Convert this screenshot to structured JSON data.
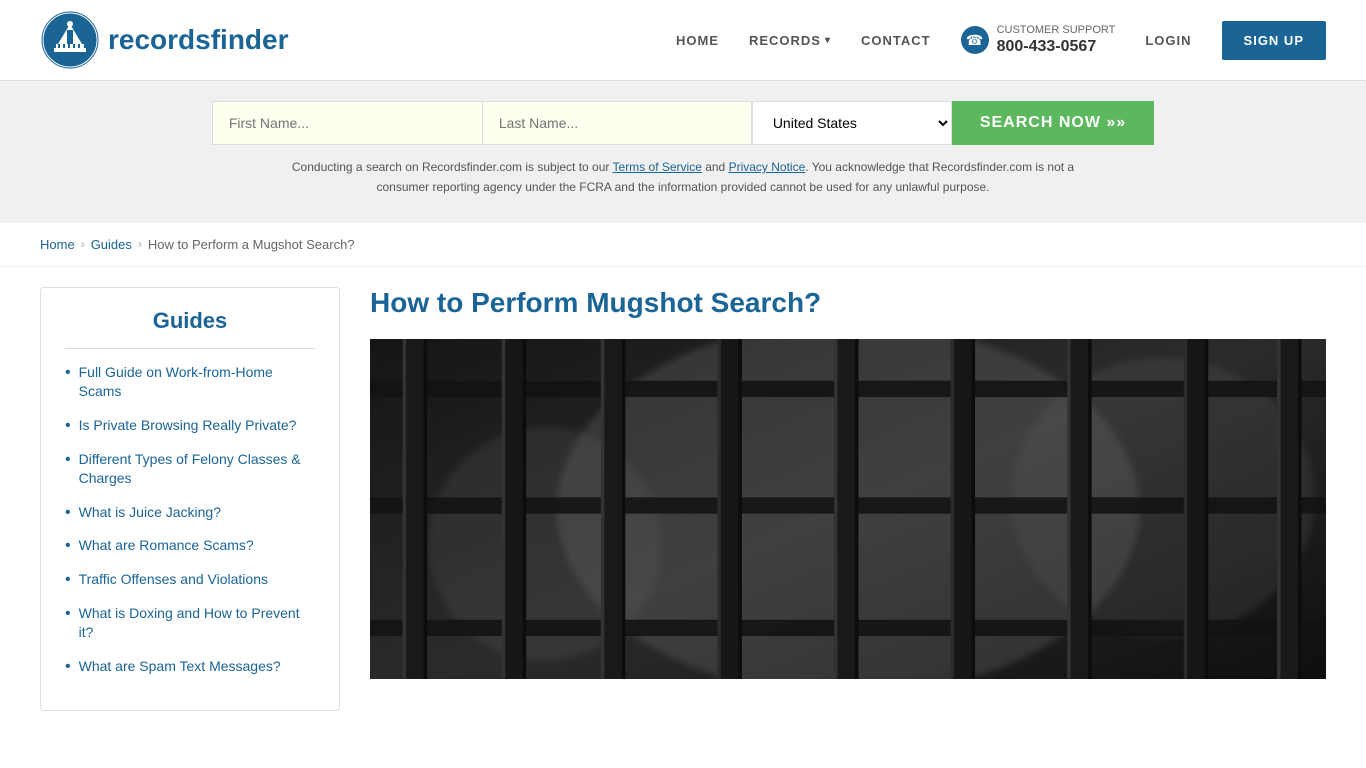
{
  "header": {
    "logo_text_regular": "records",
    "logo_text_bold": "finder",
    "nav": {
      "home_label": "HOME",
      "records_label": "RECORDS",
      "contact_label": "CONTACT",
      "support_label": "CUSTOMER SUPPORT",
      "support_phone": "800-433-0567",
      "login_label": "LOGIN",
      "signup_label": "SIGN UP"
    }
  },
  "search": {
    "first_name_placeholder": "First Name...",
    "last_name_placeholder": "Last Name...",
    "country_default": "United States",
    "country_options": [
      "United States"
    ],
    "search_button": "SEARCH NOW »»",
    "disclaimer": "Conducting a search on Recordsfinder.com is subject to our Terms of Service and Privacy Notice. You acknowledge that Recordsfinder.com is not a consumer reporting agency under the FCRA and the information provided cannot be used for any unlawful purpose.",
    "tos_label": "Terms of Service",
    "privacy_label": "Privacy Notice"
  },
  "breadcrumb": {
    "home": "Home",
    "guides": "Guides",
    "current": "How to Perform a Mugshot Search?"
  },
  "sidebar": {
    "title": "Guides",
    "items": [
      {
        "label": "Full Guide on Work-from-Home Scams"
      },
      {
        "label": "Is Private Browsing Really Private?"
      },
      {
        "label": "Different Types of Felony Classes & Charges"
      },
      {
        "label": "What is Juice Jacking?"
      },
      {
        "label": "What are Romance Scams?"
      },
      {
        "label": "Traffic Offenses and Violations"
      },
      {
        "label": "What is Doxing and How to Prevent it?"
      },
      {
        "label": "What are Spam Text Messages?"
      }
    ]
  },
  "article": {
    "title": "How to Perform Mugshot Search?",
    "image_alt": "Prison bars - mugshot search article hero image"
  }
}
